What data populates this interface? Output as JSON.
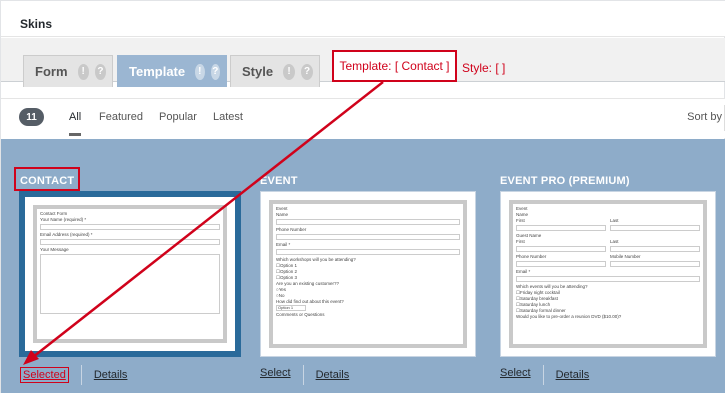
{
  "header": {
    "title": "Skins"
  },
  "tabs": [
    {
      "label": "Form",
      "icon1": "!",
      "icon2": "?"
    },
    {
      "label": "Template",
      "icon1": "!",
      "icon2": "?"
    },
    {
      "label": "Style",
      "icon1": "!",
      "icon2": "?"
    }
  ],
  "status": {
    "template_text": "Template: [ Contact ]",
    "style_text": "Style: [  ]"
  },
  "filters": {
    "count": "11",
    "items": [
      "All",
      "Featured",
      "Popular",
      "Latest"
    ],
    "sort_label": "Sort by"
  },
  "skins": [
    {
      "name": "CONTACT",
      "action_label": "Selected",
      "details_label": "Details",
      "form": {
        "title": "Contact Form",
        "fields": [
          "Your Name (required) *",
          "Email Address (required) *",
          "Your Message"
        ]
      }
    },
    {
      "name": "EVENT",
      "action_label": "Select",
      "details_label": "Details",
      "form": {
        "title": "Event",
        "fields": [
          "Name",
          "Phone Number",
          "Email *"
        ],
        "q1": "Which workshops will you be attending?",
        "q1_options": [
          "Option 1",
          "Option 2",
          "Option 3"
        ],
        "q2": "Are you an existing customer??",
        "q2_options": [
          "Yes",
          "No"
        ],
        "q3": "How did find out about this event?",
        "q3_select": "Option 1",
        "q4": "Comments or Questions"
      }
    },
    {
      "name": "EVENT PRO (PREMIUM)",
      "action_label": "Select",
      "details_label": "Details",
      "form": {
        "title": "Event",
        "name_label": "Name",
        "first": "First",
        "last": "Last",
        "guest_label": "Guest Name",
        "first2": "First",
        "last2": "Last",
        "phone": "Phone Number",
        "mobile": "Mobile Number",
        "email": "Email *",
        "q1": "Which events will you be attending?",
        "q1_options": [
          "Friday night cocktail",
          "Saturday breakfast",
          "Saturday lunch",
          "Saturday formal dinner"
        ],
        "q2": "Would you like to pre-order a reunion DVD ($10.00)?"
      }
    }
  ],
  "colors": {
    "accent_red": "#d0021b",
    "grid_background": "#8eacc9",
    "selected_border": "#2a6a9a",
    "active_tab": "#9bb6d2"
  }
}
